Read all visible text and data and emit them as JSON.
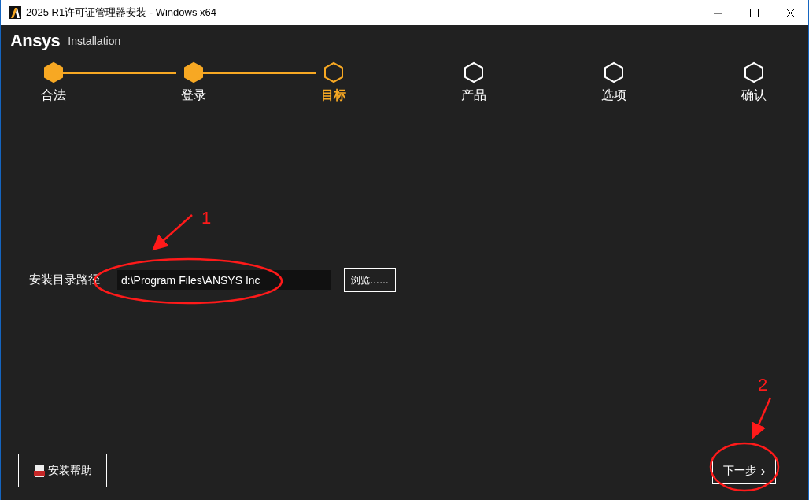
{
  "window": {
    "title": "2025 R1许可证管理器安装 - Windows x64"
  },
  "header": {
    "logo": "Ansys",
    "subtitle": "Installation"
  },
  "steps": [
    {
      "label": "合法",
      "completed": true,
      "selected": false
    },
    {
      "label": "登录",
      "completed": true,
      "selected": false
    },
    {
      "label": "目标",
      "completed": false,
      "selected": true
    },
    {
      "label": "产品",
      "completed": false,
      "selected": false
    },
    {
      "label": "选项",
      "completed": false,
      "selected": false
    },
    {
      "label": "确认",
      "completed": false,
      "selected": false
    }
  ],
  "install_path": {
    "label": "安装目录路径",
    "value": "d:\\Program Files\\ANSYS Inc",
    "browse_button": "浏览……"
  },
  "footer": {
    "help_button": "安装帮助",
    "next_button": "下一步",
    "next_icon": "›"
  },
  "annotations": [
    {
      "number": "1"
    },
    {
      "number": "2"
    }
  ]
}
